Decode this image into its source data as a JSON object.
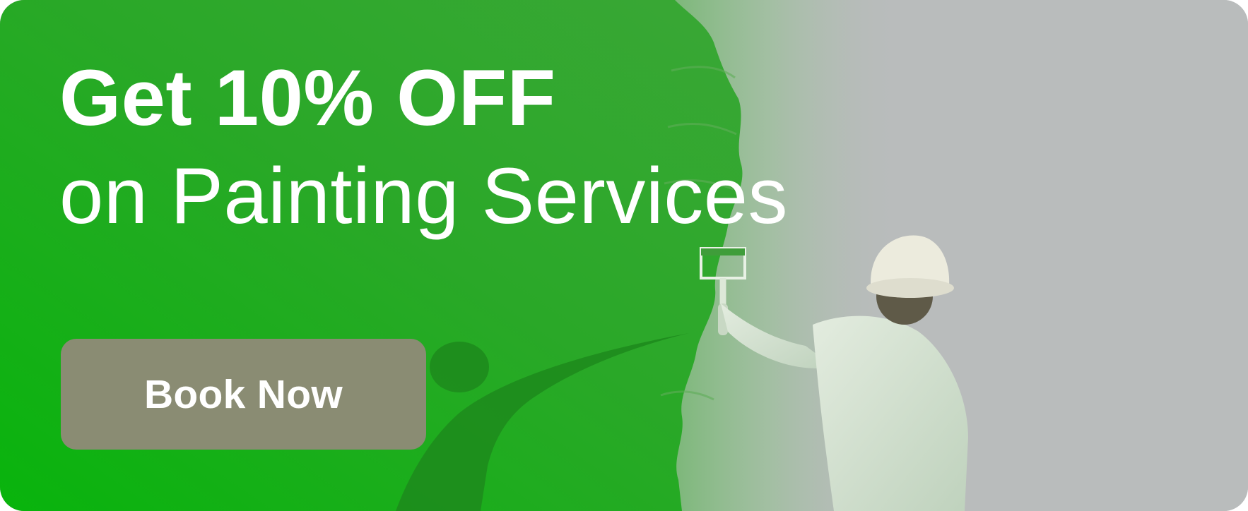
{
  "promo": {
    "headline_strong": "Get 10% OFF",
    "headline_light": "on Painting Services",
    "cta_label": "Book Now"
  },
  "colors": {
    "brand_green": "#0bb80f",
    "wall_gray": "#b9bcbc",
    "cta_background": "#8a8c73",
    "text": "#ffffff"
  },
  "icons": {
    "worker_illustration": "painter-worker-icon",
    "paint_roller": "paint-roller-icon"
  }
}
